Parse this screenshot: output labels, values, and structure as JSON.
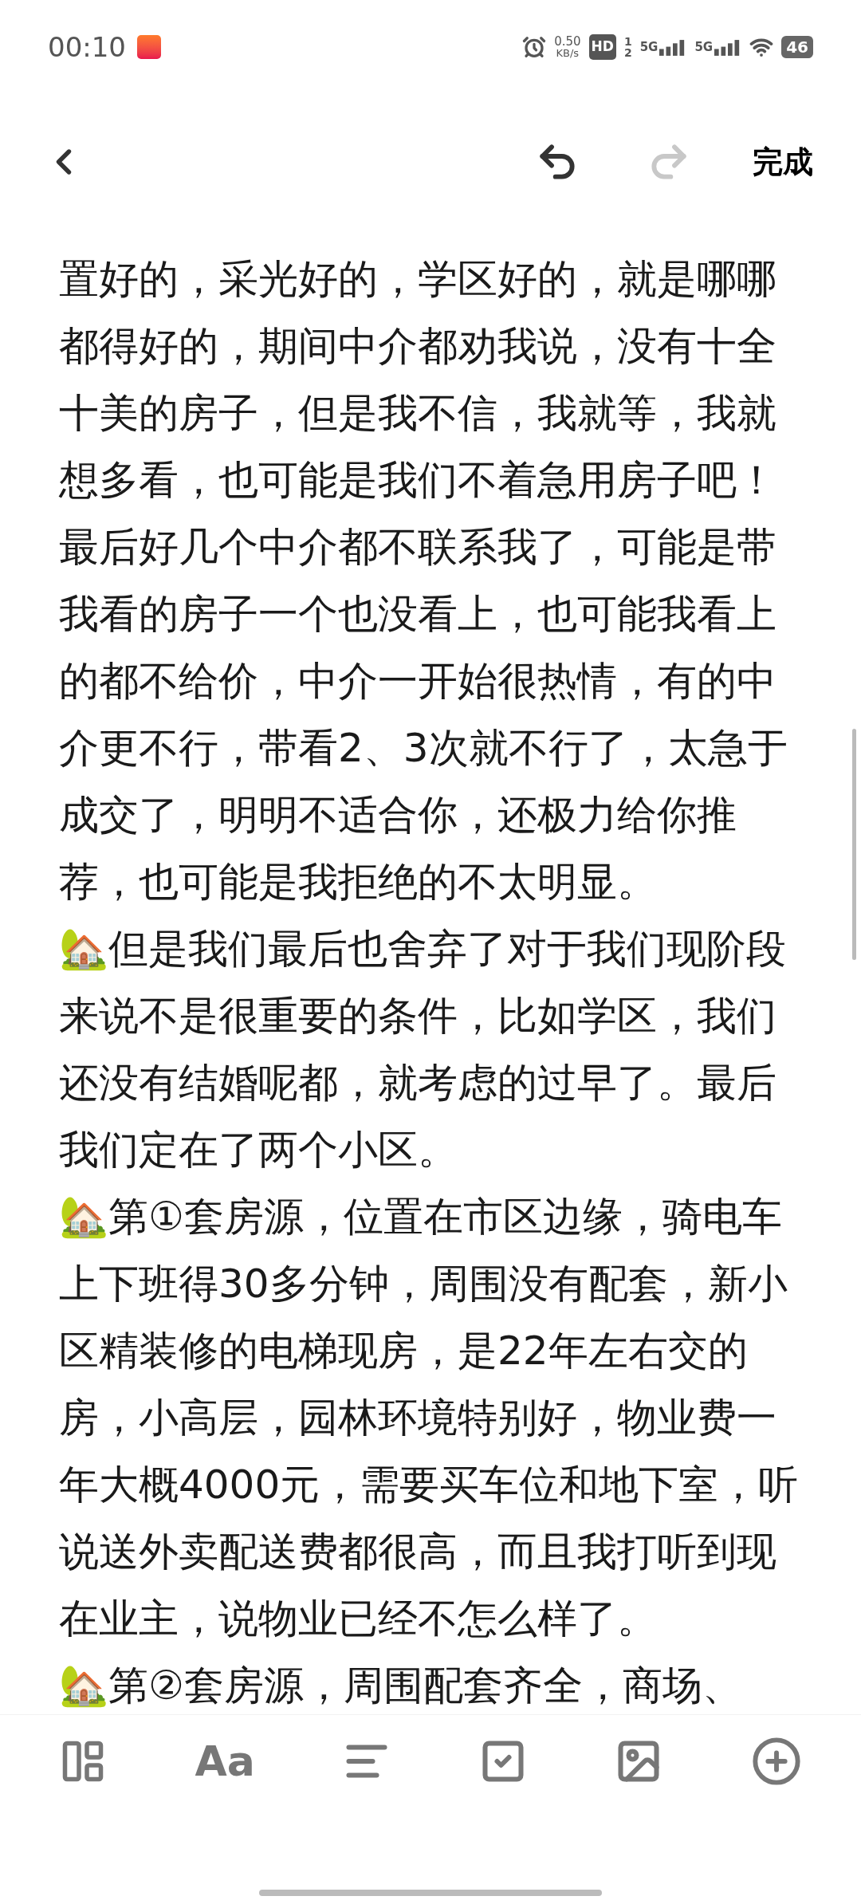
{
  "status_bar": {
    "time": "00:10",
    "speed_value": "0.50",
    "speed_unit": "KB/s",
    "hd_label": "HD",
    "hd_sup": "1",
    "hd_sub": "2",
    "networks": [
      "5G",
      "5G"
    ],
    "battery": "46"
  },
  "top_bar": {
    "undo": {
      "disabled": false
    },
    "redo": {
      "disabled": true
    },
    "done": "完成"
  },
  "paragraphs": [
    {
      "text": "置好的，采光好的，学区好的，就是哪哪都得好的，期间中介都劝我说，没有十全十美的房子，但是我不信，我就等，我就想多看，也可能是我们不着急用房子吧！最后好几个中介都不联系我了，可能是带我看的房子一个也没看上，也可能我看上的都不给价，中介一开始很热情，有的中介更不行，带看2、3次就不行了，太急于成交了，明明不适合你，还极力给你推荐，也可能是我拒绝的不太明显。"
    },
    {
      "text": "🏡但是我们最后也舍弃了对于我们现阶段来说不是很重要的条件，比如学区，我们还没有结婚呢都，就考虑的过早了。最后我们定在了两个小区。"
    },
    {
      "text": "🏡第①套房源，位置在市区边缘，骑电车上下班得30多分钟，周围没有配套，新小区精装修的电梯现房，是22年左右交的房，小高层，园林环境特别好，物业费一年大概4000元，需要买车位和地下室，听说送外卖配送费都很高，而且我打听到现在业主，说物业已经不怎么样了。"
    },
    {
      "text": "🏡第②套房源，周围配套齐全，商场、"
    }
  ],
  "toolbar": {
    "font_button": "Aa"
  }
}
